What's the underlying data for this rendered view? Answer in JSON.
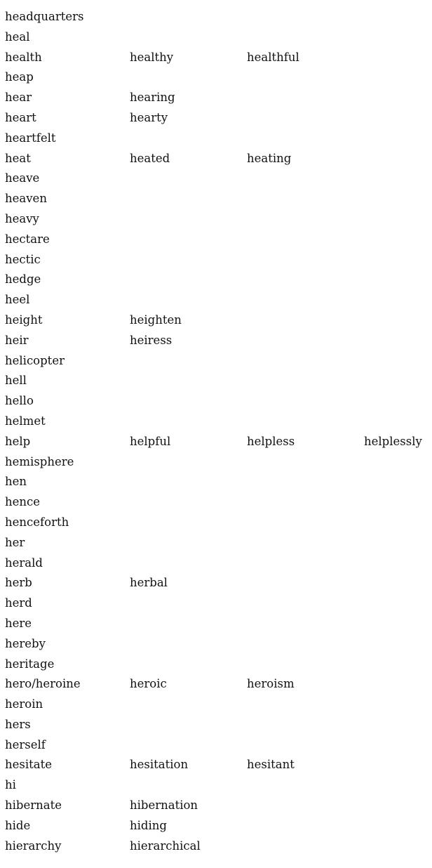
{
  "rows": [
    [
      "headquarters"
    ],
    [
      "heal"
    ],
    [
      "health",
      "healthy",
      "healthful"
    ],
    [
      "heap"
    ],
    [
      "hear",
      "hearing"
    ],
    [
      "heart",
      "hearty"
    ],
    [
      "heartfelt"
    ],
    [
      "heat",
      "heated",
      "heating"
    ],
    [
      "heave"
    ],
    [
      "heaven"
    ],
    [
      "heavy"
    ],
    [
      "hectare"
    ],
    [
      "hectic"
    ],
    [
      "hedge"
    ],
    [
      "heel"
    ],
    [
      "height",
      "heighten"
    ],
    [
      "heir",
      "heiress"
    ],
    [
      "helicopter"
    ],
    [
      "hell"
    ],
    [
      "hello"
    ],
    [
      "helmet"
    ],
    [
      "help",
      "helpful",
      "helpless",
      "helplessly"
    ],
    [
      "hemisphere"
    ],
    [
      "hen"
    ],
    [
      "hence"
    ],
    [
      "henceforth"
    ],
    [
      "her"
    ],
    [
      "herald"
    ],
    [
      "herb",
      "herbal"
    ],
    [
      "herd"
    ],
    [
      "here"
    ],
    [
      "hereby"
    ],
    [
      "heritage"
    ],
    [
      "hero/heroine",
      "heroic",
      "heroism"
    ],
    [
      "heroin"
    ],
    [
      "hers"
    ],
    [
      "herself"
    ],
    [
      "hesitate",
      "hesitation",
      "hesitant"
    ],
    [
      "hi"
    ],
    [
      "hibernate",
      "hibernation"
    ],
    [
      "hide",
      "hiding"
    ],
    [
      "hierarchy",
      "hierarchical"
    ]
  ]
}
